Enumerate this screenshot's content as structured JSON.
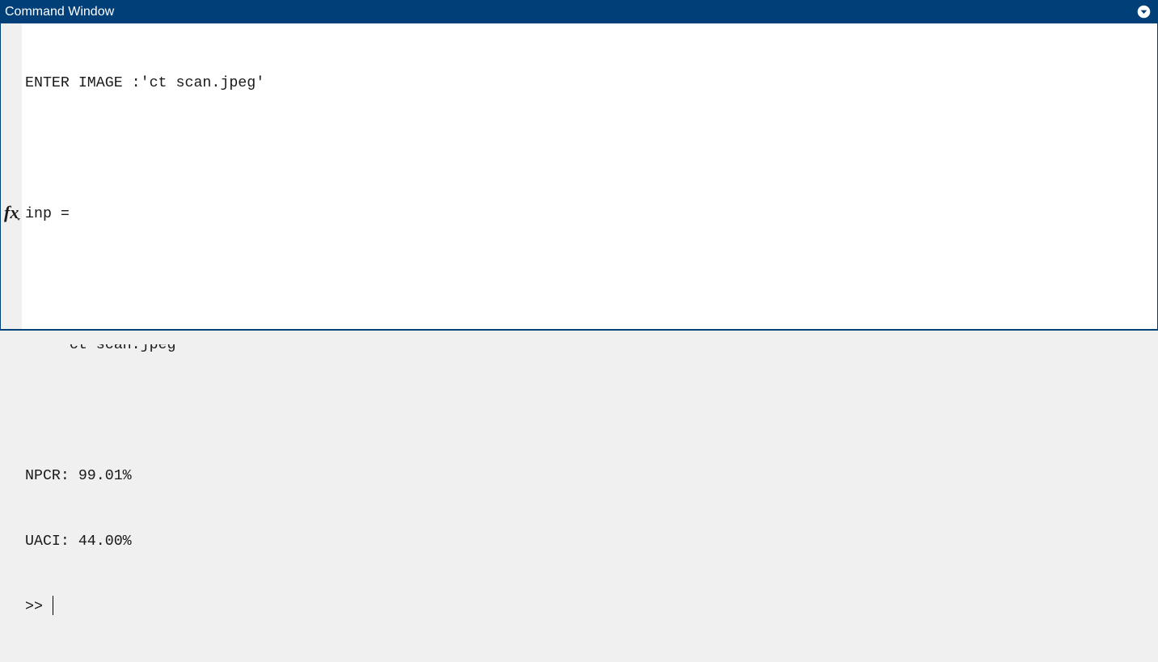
{
  "window": {
    "title": "Command Window",
    "menu_icon": "circle-chevron-down-icon"
  },
  "console": {
    "lines": [
      "ENTER IMAGE :'ct scan.jpeg'",
      "",
      "inp =",
      "",
      "    'ct scan.jpeg'",
      "",
      "NPCR: 99.01%",
      "UACI: 44.00%"
    ],
    "prompt": ">>",
    "input_value": ""
  },
  "function_browser": {
    "label": "fx",
    "icon": "fx-function-browser-icon"
  },
  "colors": {
    "title_bar": "#003f77",
    "title_text": "#ffffff",
    "background": "#ffffff",
    "gutter": "#f0f0f0"
  }
}
